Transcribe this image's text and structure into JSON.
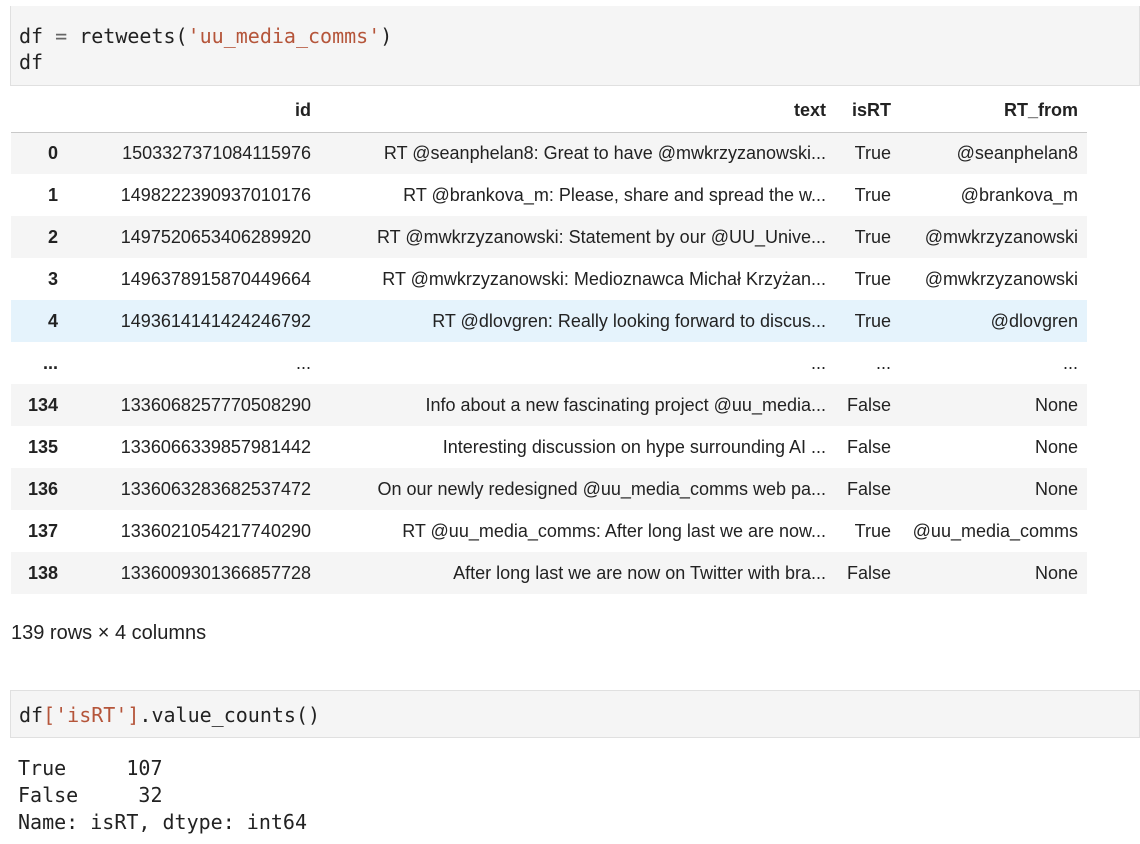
{
  "cell1": {
    "line1": {
      "var": "df",
      "op": " = ",
      "fn": "retweets(",
      "arg": "'uu_media_comms'",
      "close": ")"
    },
    "line2": "df"
  },
  "dataframe": {
    "columns": [
      "",
      "id",
      "text",
      "isRT",
      "RT_from"
    ],
    "rows": [
      {
        "idx": "0",
        "id": "1503327371084115976",
        "text": "RT @seanphelan8: Great to have @mwkrzyzanowski...",
        "isRT": "True",
        "RT_from": "@seanphelan8"
      },
      {
        "idx": "1",
        "id": "1498222390937010176",
        "text": "RT @brankova_m: Please, share and spread the w...",
        "isRT": "True",
        "RT_from": "@brankova_m"
      },
      {
        "idx": "2",
        "id": "1497520653406289920",
        "text": "RT @mwkrzyzanowski: Statement by our @UU_Unive...",
        "isRT": "True",
        "RT_from": "@mwkrzyzanowski"
      },
      {
        "idx": "3",
        "id": "1496378915870449664",
        "text": "RT @mwkrzyzanowski: Medioznawca Michał Krzyżan...",
        "isRT": "True",
        "RT_from": "@mwkrzyzanowski"
      },
      {
        "idx": "4",
        "id": "1493614141424246792",
        "text": "RT @dlovgren: Really looking forward to discus...",
        "isRT": "True",
        "RT_from": "@dlovgren"
      },
      {
        "idx": "...",
        "id": "...",
        "text": "...",
        "isRT": "...",
        "RT_from": "..."
      },
      {
        "idx": "134",
        "id": "1336068257770508290",
        "text": "Info about a new fascinating project @uu_media...",
        "isRT": "False",
        "RT_from": "None"
      },
      {
        "idx": "135",
        "id": "1336066339857981442",
        "text": "Interesting discussion on hype surrounding AI ...",
        "isRT": "False",
        "RT_from": "None"
      },
      {
        "idx": "136",
        "id": "1336063283682537472",
        "text": "On our newly redesigned @uu_media_comms web pa...",
        "isRT": "False",
        "RT_from": "None"
      },
      {
        "idx": "137",
        "id": "1336021054217740290",
        "text": "RT @uu_media_comms: After long last we are now...",
        "isRT": "True",
        "RT_from": "@uu_media_comms"
      },
      {
        "idx": "138",
        "id": "1336009301366857728",
        "text": "After long last we are now on Twitter with bra...",
        "isRT": "False",
        "RT_from": "None"
      }
    ],
    "shape_text": "139 rows × 4 columns"
  },
  "cell2": {
    "code": {
      "var": "df",
      "arg": "['isRT']",
      "method": ".value_counts()"
    }
  },
  "output2": {
    "lines": [
      "True     107",
      "False     32",
      "Name: isRT, dtype: int64"
    ]
  },
  "colors": {
    "cell_bg": "#f5f5f5",
    "stripe_bg": "#f5f5f5",
    "hover_bg": "#e5f3fc",
    "string_color": "#b5553a"
  }
}
